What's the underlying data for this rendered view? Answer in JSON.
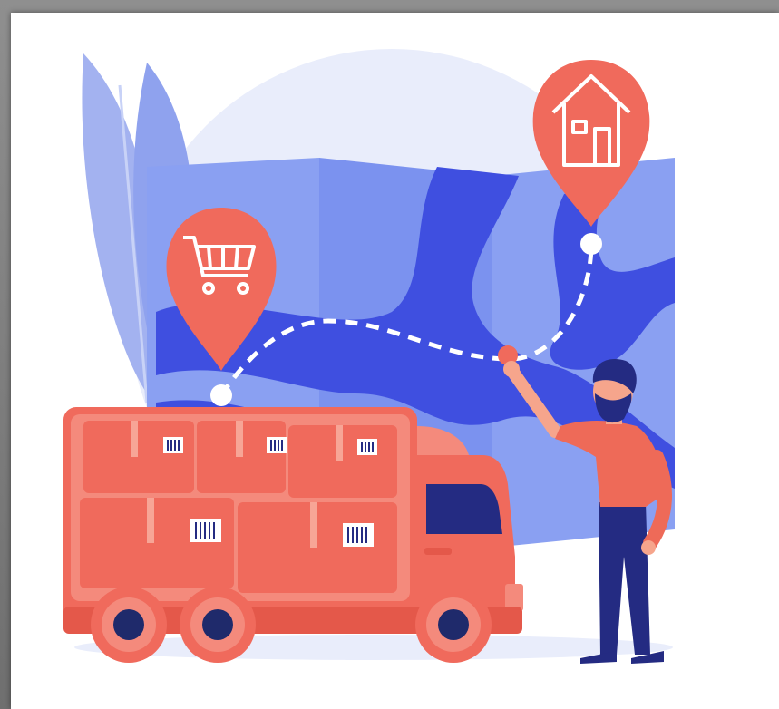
{
  "illustration": {
    "subject": "delivery-truck-route-map",
    "icons": [
      "shopping-cart-icon",
      "house-icon",
      "barcode-icon"
    ]
  },
  "colors": {
    "background_circle": "#e9edfb",
    "map_light": "#8aa0f2",
    "map_mid": "#6f86ec",
    "river": "#3f4fe0",
    "leaf": "#a3b2f0",
    "pin": "#f06a5c",
    "truck": "#f06a5c",
    "truck_light": "#f48a7c",
    "tire": "#1f2a6b",
    "person_shirt": "#ee6a58",
    "person_pants": "#242b82",
    "route": "#ffffff"
  }
}
